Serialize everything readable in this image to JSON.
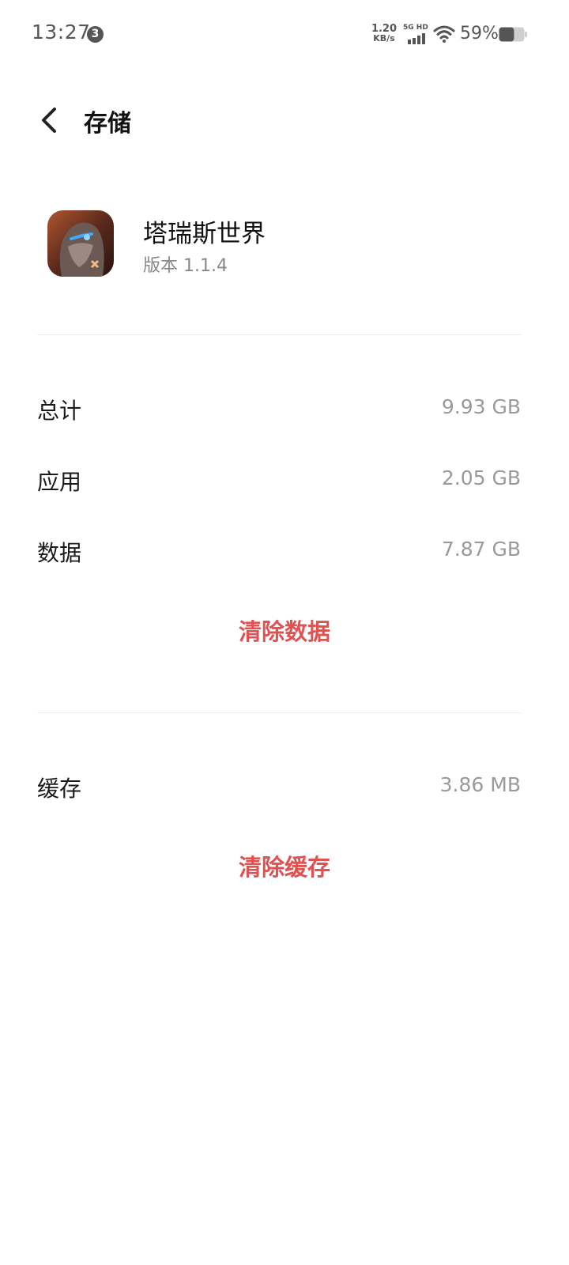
{
  "status_bar": {
    "time": "13:27",
    "notification_count": "3",
    "net_speed_value": "1.20",
    "net_speed_unit": "KB/s",
    "network_type": "5G HD",
    "battery_percent": "59%",
    "battery_level": 0.59
  },
  "header": {
    "title": "存储"
  },
  "app": {
    "name": "塔瑞斯世界",
    "version": "版本 1.1.4"
  },
  "storage": {
    "rows": [
      {
        "label": "总计",
        "value": "9.93 GB"
      },
      {
        "label": "应用",
        "value": "2.05 GB"
      },
      {
        "label": "数据",
        "value": "7.87 GB"
      }
    ],
    "clear_data_label": "清除数据"
  },
  "cache": {
    "label": "缓存",
    "value": "3.86 MB",
    "clear_cache_label": "清除缓存"
  },
  "colors": {
    "accent_red": "#e05252",
    "value_gray": "#9a9a9a",
    "divider": "#ececec"
  }
}
